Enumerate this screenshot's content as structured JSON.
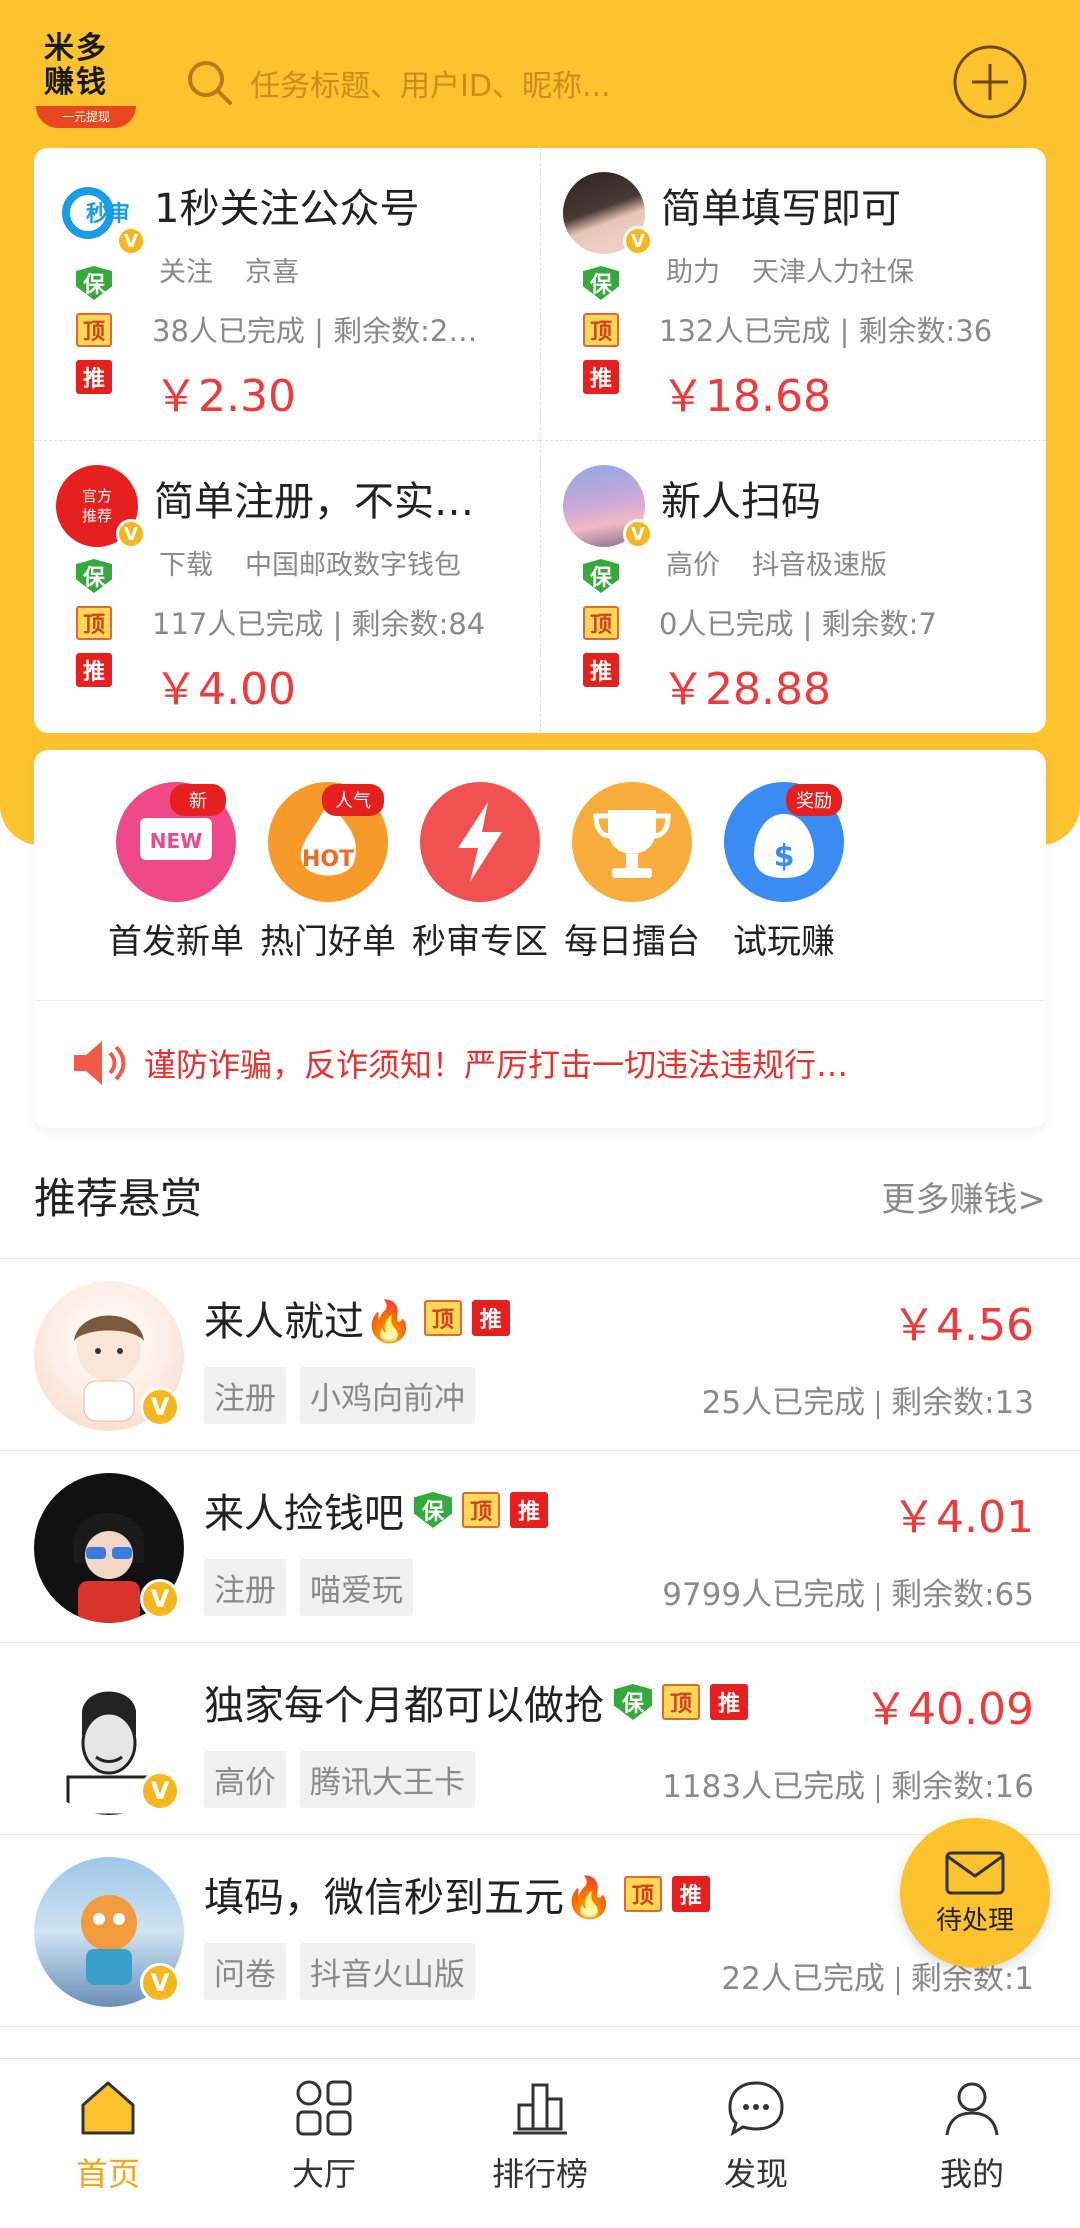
{
  "search": {
    "placeholder": "任务标题、用户ID、昵称..."
  },
  "logo": {
    "line1": "米多",
    "line2": "赚钱",
    "tagline": "一元提现"
  },
  "featured": [
    {
      "title": "1秒关注公众号",
      "tags": [
        "关注",
        "京喜"
      ],
      "stats": "38人已完成 | 剩余数:2…",
      "price": "￥2.30",
      "avatar_text": "秒审"
    },
    {
      "title": "简单填写即可",
      "tags": [
        "助力",
        "天津人力社保"
      ],
      "stats": "132人已完成 | 剩余数:36",
      "price": "￥18.68",
      "avatar_text": ""
    },
    {
      "title": "简单注册，不实…",
      "tags": [
        "下载",
        "中国邮政数字钱包"
      ],
      "stats": "117人已完成 | 剩余数:84",
      "price": "￥4.00",
      "avatar_text": "官方推荐"
    },
    {
      "title": "新人扫码",
      "tags": [
        "高价",
        "抖音极速版"
      ],
      "stats": "0人已完成 | 剩余数:7",
      "price": "￥28.88",
      "avatar_text": ""
    }
  ],
  "badges": {
    "bao": "保",
    "ding": "顶",
    "tui": "推",
    "v": "V"
  },
  "categories": [
    {
      "label": "首发新单",
      "icon": "new-icon",
      "tag": "新",
      "inner": "NEW"
    },
    {
      "label": "热门好单",
      "icon": "hot-icon",
      "tag": "人气",
      "inner": "HOT"
    },
    {
      "label": "秒审专区",
      "icon": "lightning-icon",
      "tag": "",
      "inner": ""
    },
    {
      "label": "每日擂台",
      "icon": "trophy-icon",
      "tag": "",
      "inner": ""
    },
    {
      "label": "试玩赚",
      "icon": "money-bag-icon",
      "tag": "奖励",
      "inner": "$"
    }
  ],
  "notice": {
    "text": "谨防诈骗，反诈须知！严厉打击一切违法违规行…"
  },
  "section": {
    "title": "推荐悬赏",
    "more": "更多赚钱>"
  },
  "rows": [
    {
      "title": "来人就过🔥",
      "badges": [
        "ding",
        "tui"
      ],
      "tags": [
        "注册",
        "小鸡向前冲"
      ],
      "price": "￥4.56",
      "done": "25人已完成",
      "remain": "剩余数:13"
    },
    {
      "title": "来人捡钱吧",
      "badges": [
        "bao",
        "ding",
        "tui"
      ],
      "tags": [
        "注册",
        "喵爱玩"
      ],
      "price": "￥4.01",
      "done": "9799人已完成",
      "remain": "剩余数:65"
    },
    {
      "title": "独家每个月都可以做抢",
      "badges": [
        "bao",
        "ding",
        "tui"
      ],
      "tags": [
        "高价",
        "腾讯大王卡"
      ],
      "price": "￥40.09",
      "done": "1183人已完成",
      "remain": "剩余数:16"
    },
    {
      "title": "填码，微信秒到五元🔥",
      "badges": [
        "ding",
        "tui"
      ],
      "tags": [
        "问卷",
        "抖音火山版"
      ],
      "price": "",
      "done": "22人已完成",
      "remain": "剩余数:1"
    }
  ],
  "fab": {
    "label": "待处理"
  },
  "nav": [
    {
      "label": "首页",
      "icon": "home-icon",
      "active": true
    },
    {
      "label": "大厅",
      "icon": "grid-icon",
      "active": false
    },
    {
      "label": "排行榜",
      "icon": "ranking-icon",
      "active": false
    },
    {
      "label": "发现",
      "icon": "chat-icon",
      "active": false
    },
    {
      "label": "我的",
      "icon": "user-icon",
      "active": false
    }
  ],
  "colors": {
    "brand_yellow": "#fcc32f",
    "price_red": "#ef3b3b",
    "notice_red": "#e8312d",
    "active_nav": "#f3a81d"
  }
}
